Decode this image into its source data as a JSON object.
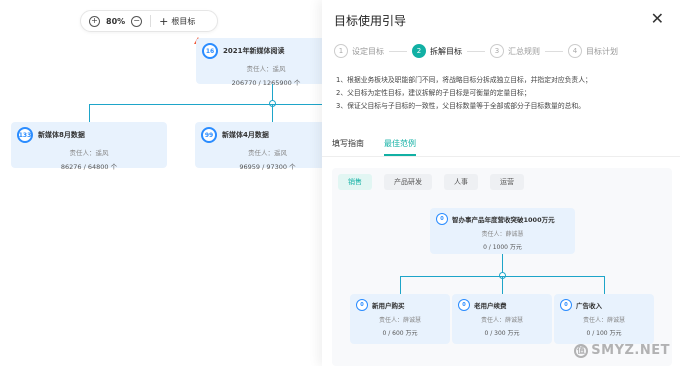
{
  "toolbar": {
    "zoom": "80%",
    "zoom_in": "+",
    "zoom_out": "−",
    "add_root_label": "根目标",
    "add_plus": "+"
  },
  "canvas": {
    "root": {
      "count": "16",
      "title": "2021年新媒体阅读",
      "owner": "责任人：遥风",
      "nums": "206770 / 1265900 个"
    },
    "children": [
      {
        "count": "133",
        "title": "新媒体8月数据",
        "owner": "责任人：遥风",
        "nums": "86276 / 64800 个"
      },
      {
        "count": "99",
        "title": "新媒体4月数据",
        "owner": "责任人：遥风",
        "nums": "96959 / 97300 个"
      }
    ]
  },
  "panel": {
    "title": "目标使用引导",
    "close": "✕",
    "steps": [
      {
        "num": "1",
        "label": "设定目标",
        "active": false
      },
      {
        "num": "2",
        "label": "拆解目标",
        "active": true
      },
      {
        "num": "3",
        "label": "汇总规则",
        "active": false
      },
      {
        "num": "4",
        "label": "目标计划",
        "active": false
      }
    ],
    "rules": [
      "1、根据业务板块及职能部门不同，将战略目标分拆成独立目标，并指定对应负责人；",
      "2、父目标为定性目标，建议拆解的子目标是可衡量的定量目标；",
      "3、保证父目标与子目标的一致性，父目标数量等于全部或部分子目标数量的总和。"
    ],
    "tabs": [
      {
        "label": "填写指南",
        "active": false
      },
      {
        "label": "最佳范例",
        "active": true
      }
    ],
    "chips": [
      {
        "label": "销售",
        "active": true
      },
      {
        "label": "产品研发",
        "active": false
      },
      {
        "label": "人事",
        "active": false
      },
      {
        "label": "运营",
        "active": false
      }
    ],
    "example": {
      "root": {
        "count": "0",
        "title": "智办事产品年度营收突破1000万元",
        "owner": "责任人：薛诚慧",
        "nums": "0 / 1000 万元"
      },
      "children": [
        {
          "count": "0",
          "title": "新用户购买",
          "owner": "责任人：薛诚慧",
          "nums": "0 / 600 万元"
        },
        {
          "count": "0",
          "title": "老用户续费",
          "owner": "责任人：薛诚慧",
          "nums": "0 / 300 万元"
        },
        {
          "count": "0",
          "title": "广告收入",
          "owner": "责任人：薛诚慧",
          "nums": "0 / 100 万元"
        }
      ]
    }
  },
  "watermark": {
    "icon": "值",
    "text": "SMYZ.NET"
  },
  "colors": {
    "accent": "#12b0a4",
    "node_bg": "#e8f2fd",
    "badge": "#2a8cff",
    "connector": "#1ea5c9",
    "warning": "#f15a3a"
  }
}
